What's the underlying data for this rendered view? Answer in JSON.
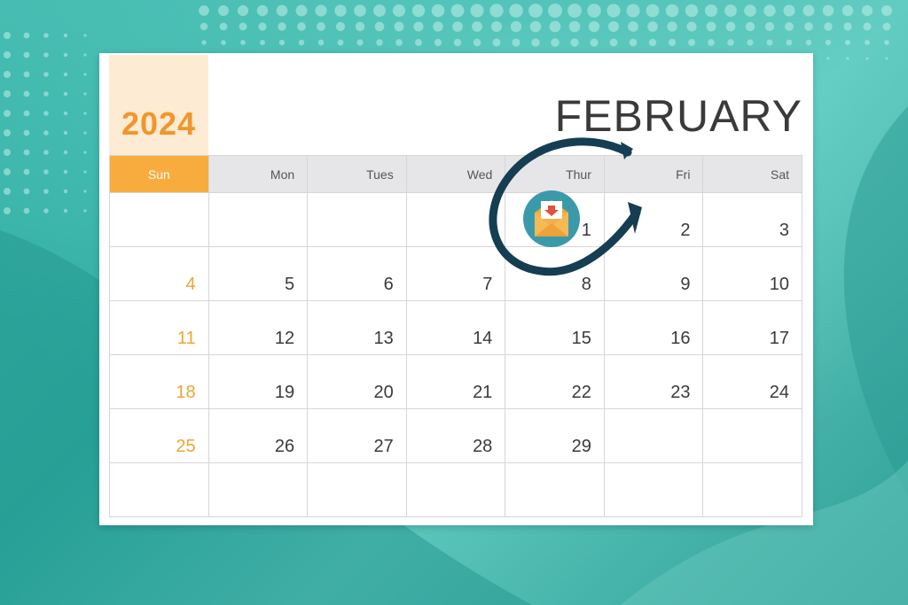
{
  "calendar": {
    "year": "2024",
    "month": "FEBRUARY",
    "weekdays": [
      "Sun",
      "Mon",
      "Tues",
      "Wed",
      "Thur",
      "Fri",
      "Sat"
    ],
    "weeks": [
      [
        "",
        "",
        "",
        "",
        "1",
        "2",
        "3"
      ],
      [
        "4",
        "5",
        "6",
        "7",
        "8",
        "9",
        "10"
      ],
      [
        "11",
        "12",
        "13",
        "14",
        "15",
        "16",
        "17"
      ],
      [
        "18",
        "19",
        "20",
        "21",
        "22",
        "23",
        "24"
      ],
      [
        "25",
        "26",
        "27",
        "28",
        "29",
        "",
        ""
      ],
      [
        "",
        "",
        "",
        "",
        "",
        "",
        ""
      ]
    ]
  },
  "highlight": {
    "date": "1",
    "icon": "mail-download-icon",
    "marker": "circle-arrow"
  },
  "colors": {
    "background": "#2aa99e",
    "accent_orange": "#f8ac3d",
    "year_text": "#f0962a",
    "header_gray": "#e6e6e8",
    "marker_navy": "#153e52",
    "icon_circle": "#3b9aaa"
  }
}
